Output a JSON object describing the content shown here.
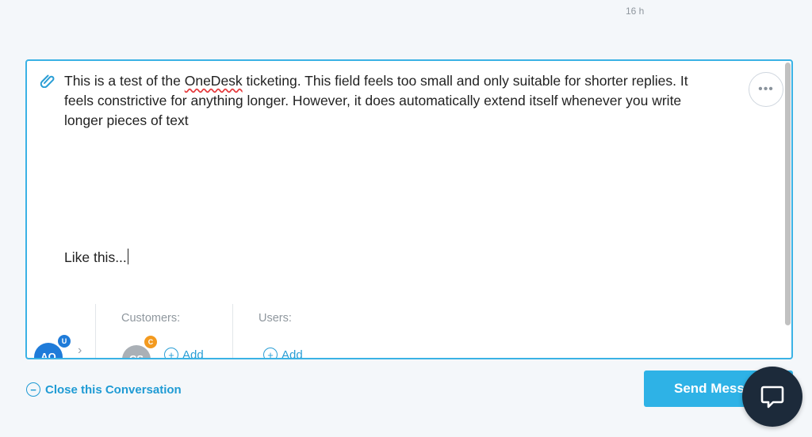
{
  "header": {
    "timestamp": "16 h"
  },
  "composer": {
    "paragraph_parts": [
      "This is a test of the ",
      "OneDesk",
      " ticketing. This field feels too small and only suitable for shorter replies. It feels constrictive for anything longer. However, it does automatically extend itself whenever you write longer pieces of text"
    ],
    "second_line": "Like this...",
    "more_label": "•••"
  },
  "recipients": {
    "current_user": {
      "initials": "AO",
      "badge": "U"
    },
    "customers_label": "Customers:",
    "customer": {
      "initials": "CS",
      "badge": "C"
    },
    "users_label": "Users:",
    "add_label": "Add"
  },
  "footer": {
    "close_label": "Close this Conversation",
    "send_label": "Send Message"
  },
  "colors": {
    "accent": "#2eb2e6",
    "border": "#3ab2e5",
    "launcher": "#1c2a3a"
  },
  "icons": {
    "attach": "paperclip-icon",
    "more": "more-options-icon",
    "chat": "chat-bubble-icon"
  }
}
